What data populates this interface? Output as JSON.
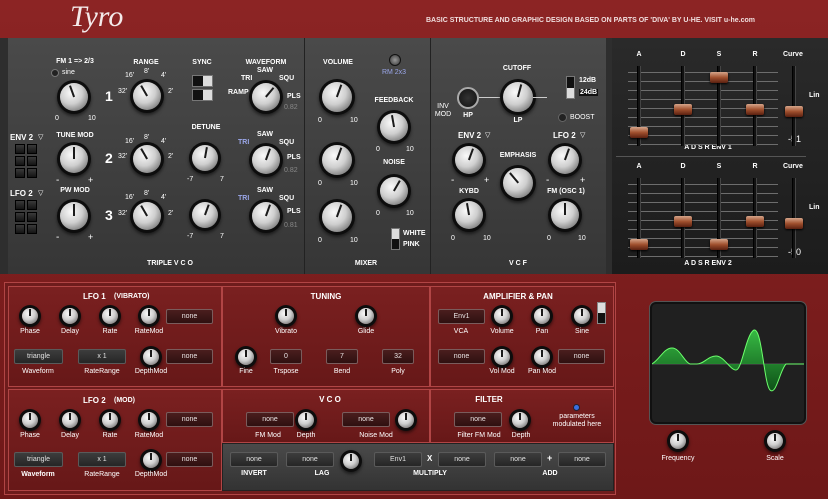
{
  "header": {
    "title": "Tyro",
    "credit": "BASIC STRUCTURE AND GRAPHIC DESIGN BASED ON PARTS OF 'DIVA' BY U-HE.  VISIT u-he.com"
  },
  "vco": {
    "section_label": "TRIPLE  V C O",
    "fm_label": "FM  1 => 2/3",
    "sine_label": "sine",
    "range_label": "RANGE",
    "sync_label": "SYNC",
    "waveform_label": "WAVEFORM",
    "detune_label": "DETUNE",
    "tune_mod_label": "TUNE  MOD",
    "pw_mod_label": "PW  MOD",
    "env2_label": "ENV 2",
    "lfo2_label": "LFO 2",
    "osc_numbers": [
      "1",
      "2",
      "3"
    ],
    "range_ticks": [
      "16'",
      "8'",
      "4'",
      "32'",
      "2'"
    ],
    "wave_tri": "TRI",
    "wave_saw": "SAW",
    "wave_squ": "SQU",
    "wave_ramp": "RAMP",
    "wave_pls": "PLS",
    "pw_values": [
      "0.82",
      "0.82",
      "0.81"
    ],
    "s0": "0",
    "s10": "10",
    "minus": "-",
    "plus": "+",
    "m7": "-7",
    "p7": "7"
  },
  "mixer": {
    "section_label": "MIXER",
    "volume": "VOLUME",
    "rm": "RM  2x3",
    "feedback": "FEEDBACK",
    "noise": "NOISE",
    "white": "WHITE",
    "pink": "PINK",
    "s0": "0",
    "s10": "10"
  },
  "vcf": {
    "section_label": "V C F",
    "cutoff": "CUTOFF",
    "inv": "INV",
    "mod": "MOD",
    "hp": "HP",
    "lp": "LP",
    "db12": "12dB",
    "db24": "24dB",
    "boost": "BOOST",
    "env2": "ENV 2",
    "lfo2": "LFO 2",
    "emphasis": "EMPHASIS",
    "kybd": "KYBD",
    "fm_osc": "FM (OSC 1)",
    "s0": "0",
    "s10": "10",
    "minus": "-",
    "plus": "+"
  },
  "adsr": {
    "letters": [
      "A",
      "D",
      "S",
      "R"
    ],
    "curve": "Curve",
    "lin": "Lin",
    "env1_label": "A D S R   ENV 1",
    "env2_label": "A D S R   ENV 2",
    "env1_curve": "-51",
    "env2_curve": "-50",
    "env1_levels": [
      0.12,
      0.45,
      0.92,
      0.45
    ],
    "env2_levels": [
      0.12,
      0.45,
      0.12,
      0.45
    ]
  },
  "lfo1": {
    "title": "LFO 1",
    "subtitle": "(VIBRATO)",
    "phase": "Phase",
    "delay": "Delay",
    "rate": "Rate",
    "ratemod": "RateMod",
    "none": "none",
    "waveform": "Waveform",
    "waveform_value": "triangle",
    "raterange": "RateRange",
    "raterange_value": "x 1",
    "depthmod": "DepthMod"
  },
  "tuning": {
    "title": "TUNING",
    "vibrato": "Vibrato",
    "glide": "Glide",
    "fine": "Fine",
    "trspose": "Trspose",
    "bend": "Bend",
    "poly": "Poly",
    "trspose_value": "0",
    "bend_value": "7",
    "poly_value": "32"
  },
  "amp": {
    "title": "AMPLIFIER  &  PAN",
    "env1": "Env1",
    "vca": "VCA",
    "volume": "Volume",
    "pan": "Pan",
    "sine": "Sine",
    "none": "none",
    "volmod": "Vol Mod",
    "panmod": "Pan Mod"
  },
  "lfo2": {
    "title": "LFO 2",
    "subtitle": "(MOD)",
    "phase": "Phase",
    "delay": "Delay",
    "rate": "Rate",
    "ratemod": "RateMod",
    "none": "none",
    "waveform": "Waveform",
    "waveform_value": "triangle",
    "raterange": "RateRange",
    "raterange_value": "x 1",
    "depthmod": "DepthMod"
  },
  "vco_mod": {
    "title": "V C O",
    "fm_mod": "FM  Mod",
    "depth": "Depth",
    "noise_mod": "Noise  Mod",
    "none": "none"
  },
  "filter_mod": {
    "title": "FILTER",
    "label": "Filter  FM  Mod",
    "depth": "Depth",
    "none": "none",
    "legend": "parameters modulated here"
  },
  "bottom": {
    "invert": "INVERT",
    "lag": "LAG",
    "multiply": "MULTIPLY",
    "add": "ADD",
    "none": "none",
    "env1": "Env1",
    "x": "X",
    "plus": "+"
  },
  "scope": {
    "frequency": "Frequency",
    "scale": "Scale"
  }
}
